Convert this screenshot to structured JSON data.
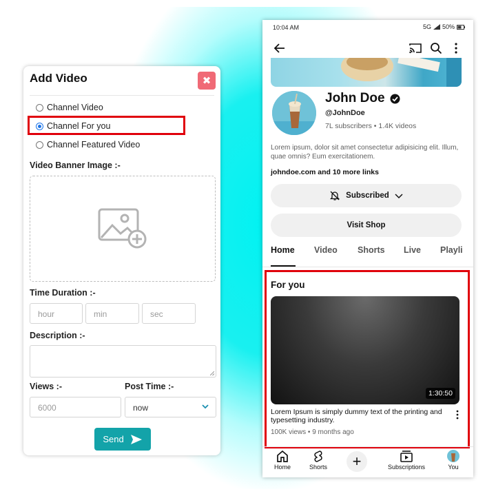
{
  "add_video": {
    "title": "Add Video",
    "close_label": "✖",
    "radio_options": [
      "Channel Video",
      "Channel For you",
      "Channel Featured Video"
    ],
    "selected_option": "Channel For you",
    "banner_label": "Video Banner Image :-",
    "time_label": "Time Duration :-",
    "time_fields": {
      "hour": "hour",
      "min": "min",
      "sec": "sec"
    },
    "description_label": "Description :-",
    "views_label": "Views :-",
    "views_placeholder": "6000",
    "post_time_label": "Post Time :-",
    "post_time_value": "now",
    "send_label": "Send"
  },
  "phone": {
    "status": {
      "time": "10:04 AM",
      "network": "5G",
      "battery": "50%"
    },
    "channel": {
      "name": "John Doe",
      "handle": "@JohnDoe",
      "stats": "7L subscribers • 1.4K videos",
      "description": "Lorem ipsum, dolor sit amet consectetur adipisicing elit. Illum, quae omnis? Eum exercitationem.",
      "links": "johndoe.com and 10 more links"
    },
    "subscribed_label": "Subscribed",
    "visit_shop_label": "Visit Shop",
    "tabs": [
      "Home",
      "Video",
      "Shorts",
      "Live",
      "Playli"
    ],
    "active_tab": "Home",
    "section_title": "For you",
    "video": {
      "duration": "1:30:50",
      "title": "Lorem Ipsum is simply dummy text of the printing and typesetting industry.",
      "meta": "100K views • 9 months ago"
    },
    "bottom_nav": [
      "Home",
      "Shorts",
      "Subscriptions",
      "You"
    ],
    "highlight_color": "#e0000b",
    "accent_color": "#13a3a9"
  }
}
